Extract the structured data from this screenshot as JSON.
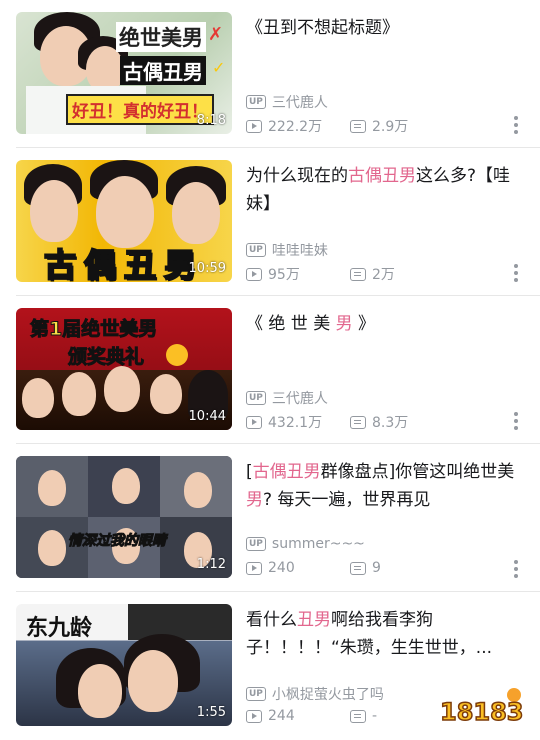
{
  "videos": [
    {
      "title_parts": [
        {
          "t": "《丑到不想起标题》",
          "hl": false
        }
      ],
      "duration": "8:18",
      "uploader": "三代鹿人",
      "views": "222.2万",
      "danmaku": "2.9万",
      "thumb": {
        "cap1": "绝世美男",
        "cap2": "古偶丑男",
        "cap3": "好丑！真的好丑！"
      }
    },
    {
      "title_parts": [
        {
          "t": "为什么现在的",
          "hl": false
        },
        {
          "t": "古偶丑男",
          "hl": true
        },
        {
          "t": "这么多?【哇妹】",
          "hl": false
        }
      ],
      "duration": "10:59",
      "uploader": "哇哇哇妹",
      "views": "95万",
      "danmaku": "2万",
      "thumb": {
        "cap1": "古偶丑男"
      }
    },
    {
      "title_parts": [
        {
          "t": "《 绝 世 美 ",
          "hl": false
        },
        {
          "t": "男",
          "hl": true
        },
        {
          "t": " 》",
          "hl": false
        }
      ],
      "duration": "10:44",
      "uploader": "三代鹿人",
      "views": "432.1万",
      "danmaku": "8.3万",
      "thumb": {
        "cap1": "第1届绝世美男",
        "cap2": "颁奖典礼"
      }
    },
    {
      "title_parts": [
        {
          "t": "[",
          "hl": false
        },
        {
          "t": "古偶丑男",
          "hl": true
        },
        {
          "t": "群像盘点]你管这叫绝世美",
          "hl": false
        },
        {
          "t": "男",
          "hl": true
        },
        {
          "t": "? 每天一遍，世界再见",
          "hl": false
        }
      ],
      "duration": "1:12",
      "uploader": "summer~~~",
      "views": "240",
      "danmaku": "9",
      "thumb": {
        "cap1": "情深过我的眼睛"
      }
    },
    {
      "title_parts": [
        {
          "t": "看什么",
          "hl": false
        },
        {
          "t": "丑男",
          "hl": true
        },
        {
          "t": "啊给我看李狗子！！！！“朱瓒，生生世世，...",
          "hl": false
        }
      ],
      "duration": "1:55",
      "uploader": "小枫捉萤火虫了吗",
      "views": "244",
      "danmaku": "-",
      "thumb": {
        "cap1": "东九龄"
      }
    }
  ],
  "up_badge": "UP",
  "watermark": "18183",
  "colors": {
    "highlight": "#e2678e",
    "meta": "#9499a0",
    "text": "#18191c"
  }
}
